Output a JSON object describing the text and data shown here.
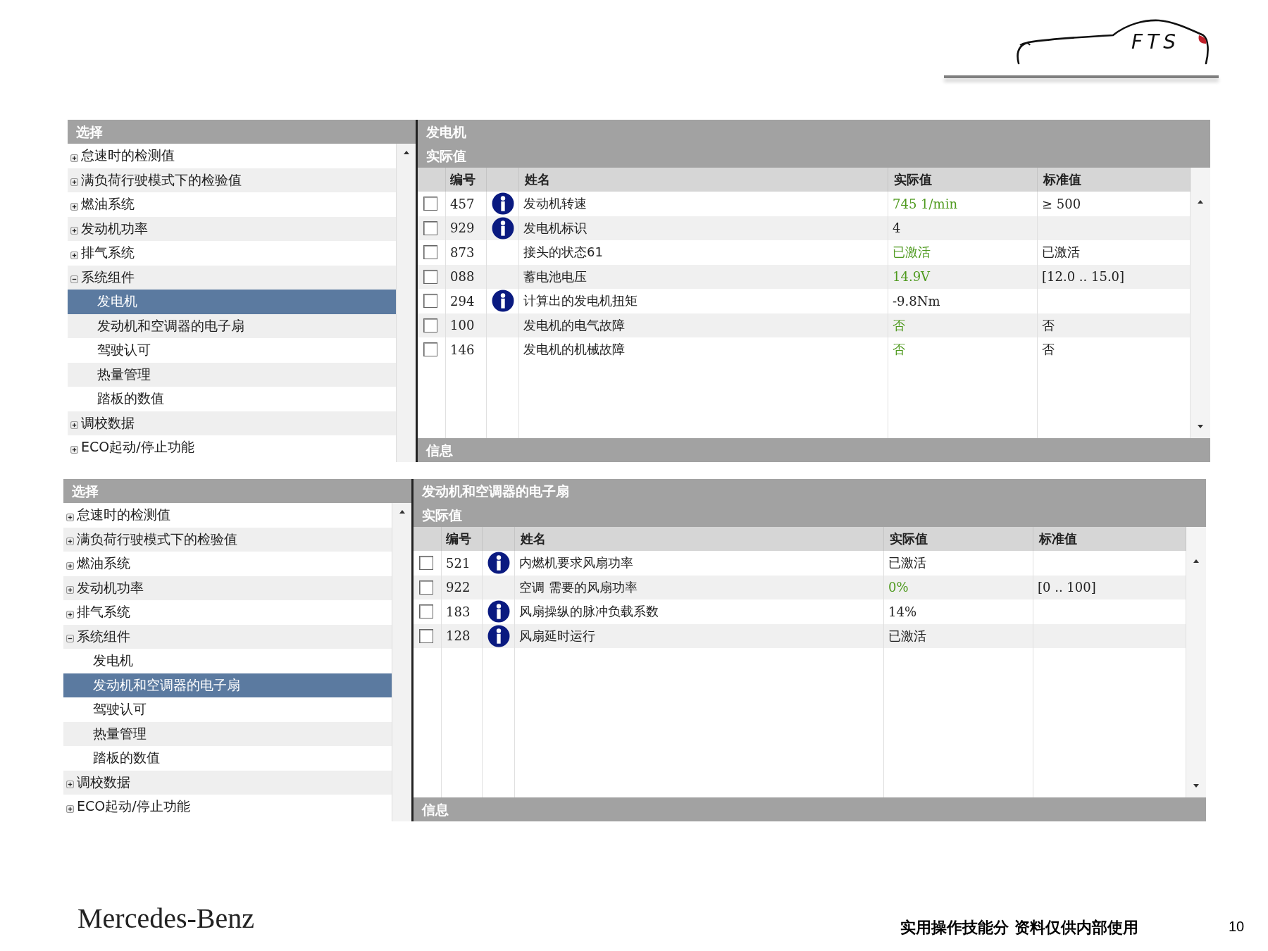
{
  "logo": {
    "text": "FTS"
  },
  "panels": [
    {
      "tree": {
        "header": "选择",
        "items": [
          {
            "label": "怠速时的检测值",
            "expanded": false,
            "selected": false
          },
          {
            "label": "满负荷行驶模式下的检验值",
            "expanded": false,
            "selected": false
          },
          {
            "label": "燃油系统",
            "expanded": false,
            "selected": false
          },
          {
            "label": "发动机功率",
            "expanded": false,
            "selected": false
          },
          {
            "label": "排气系统",
            "expanded": false,
            "selected": false
          },
          {
            "label": "系统组件",
            "expanded": true,
            "selected": false,
            "children": [
              {
                "label": "发电机",
                "selected": true
              },
              {
                "label": "发动机和空调器的电子扇",
                "selected": false
              },
              {
                "label": "驾驶认可",
                "selected": false
              },
              {
                "label": "热量管理",
                "selected": false
              },
              {
                "label": "踏板的数值",
                "selected": false
              }
            ]
          },
          {
            "label": "调校数据",
            "expanded": false,
            "selected": false
          },
          {
            "label": "ECO起动/停止功能",
            "expanded": false,
            "selected": false
          }
        ]
      },
      "detail": {
        "title": "发电机",
        "subtitle": "实际值",
        "columns": [
          "编号",
          "姓名",
          "实际值",
          "标准值"
        ],
        "rows": [
          {
            "checked": false,
            "number": "457",
            "info": true,
            "name": "发动机转速",
            "actual": "745 1/min",
            "actual_ok": true,
            "standard": "≥ 500"
          },
          {
            "checked": false,
            "number": "929",
            "info": true,
            "name": "发电机标识",
            "actual": "4",
            "actual_ok": false
          },
          {
            "checked": false,
            "number": "873",
            "info": false,
            "name": "接头的状态61",
            "actual": "已激活",
            "actual_ok": true,
            "standard": "已激活"
          },
          {
            "checked": false,
            "number": "088",
            "info": false,
            "name": "蓄电池电压",
            "actual": "14.9V",
            "actual_ok": true,
            "standard": "[12.0 .. 15.0]"
          },
          {
            "checked": false,
            "number": "294",
            "info": true,
            "name": "计算出的发电机扭矩",
            "actual": "-9.8Nm",
            "actual_ok": false
          },
          {
            "checked": false,
            "number": "100",
            "info": false,
            "name": "发电机的电气故障",
            "actual": "否",
            "actual_ok": true,
            "standard": "否"
          },
          {
            "checked": false,
            "number": "146",
            "info": false,
            "name": "发电机的机械故障",
            "actual": "否",
            "actual_ok": true,
            "standard": "否"
          }
        ],
        "info_bar": "信息"
      }
    },
    {
      "tree": {
        "header": "选择",
        "items": [
          {
            "label": "怠速时的检测值",
            "expanded": false,
            "selected": false
          },
          {
            "label": "满负荷行驶模式下的检验值",
            "expanded": false,
            "selected": false
          },
          {
            "label": "燃油系统",
            "expanded": false,
            "selected": false
          },
          {
            "label": "发动机功率",
            "expanded": false,
            "selected": false
          },
          {
            "label": "排气系统",
            "expanded": false,
            "selected": false
          },
          {
            "label": "系统组件",
            "expanded": true,
            "selected": false,
            "children": [
              {
                "label": "发电机",
                "selected": false
              },
              {
                "label": "发动机和空调器的电子扇",
                "selected": true
              },
              {
                "label": "驾驶认可",
                "selected": false
              },
              {
                "label": "热量管理",
                "selected": false
              },
              {
                "label": "踏板的数值",
                "selected": false
              }
            ]
          },
          {
            "label": "调校数据",
            "expanded": false,
            "selected": false
          },
          {
            "label": "ECO起动/停止功能",
            "expanded": false,
            "selected": false
          }
        ]
      },
      "detail": {
        "title": "发动机和空调器的电子扇",
        "subtitle": "实际值",
        "columns": [
          "编号",
          "姓名",
          "实际值",
          "标准值"
        ],
        "rows": [
          {
            "checked": false,
            "number": "521",
            "info": true,
            "name": "内燃机要求风扇功率",
            "actual": "已激活",
            "actual_ok": false
          },
          {
            "checked": false,
            "number": "922",
            "info": false,
            "name": "空调 需要的风扇功率",
            "actual": "0%",
            "actual_ok": true,
            "standard": "[0 .. 100]"
          },
          {
            "checked": false,
            "number": "183",
            "info": true,
            "name": "风扇操纵的脉冲负载系数",
            "actual": "14%",
            "actual_ok": false
          },
          {
            "checked": false,
            "number": "128",
            "info": true,
            "name": "风扇延时运行",
            "actual": "已激活",
            "actual_ok": false
          }
        ],
        "info_bar": "信息"
      }
    }
  ],
  "footer": {
    "brand": "Mercedes-Benz",
    "note": "实用操作技能分 资料仅供内部使用",
    "page": "10"
  }
}
